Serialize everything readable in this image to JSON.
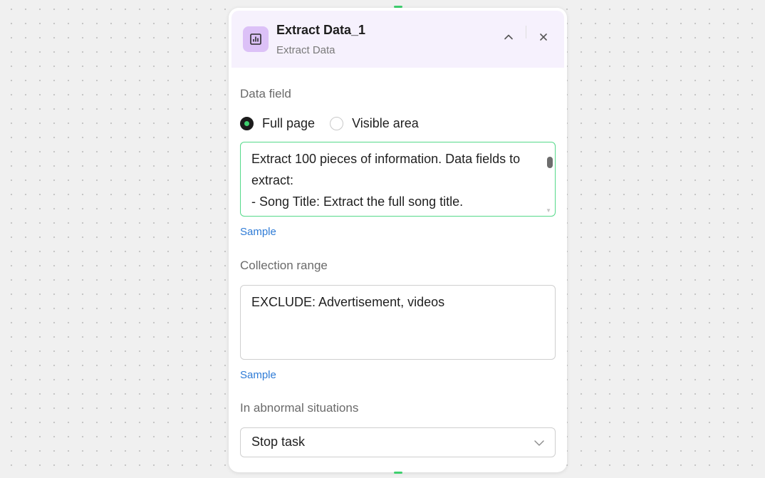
{
  "node": {
    "title": "Extract Data_1",
    "subtitle": "Extract Data",
    "icon": "bar-chart-icon",
    "accent_color": "#dcc1f7",
    "header_bg": "#f6f1fd"
  },
  "data_field": {
    "label": "Data field",
    "options": [
      {
        "label": "Full page",
        "selected": true
      },
      {
        "label": "Visible area",
        "selected": false
      }
    ],
    "text_lines": [
      "Extract 100 pieces of information. Data fields to",
      "extract:",
      "- Song Title: Extract the full song title."
    ],
    "focus_color": "#55d98a",
    "sample_label": "Sample"
  },
  "collection_range": {
    "label": "Collection range",
    "text_lines": [
      "EXCLUDE: Advertisement, videos"
    ],
    "sample_label": "Sample"
  },
  "abnormal": {
    "label": "In abnormal situations",
    "selected_value": "Stop task"
  },
  "colors": {
    "link": "#2e7bd6",
    "connector": "#3ecf6e"
  }
}
